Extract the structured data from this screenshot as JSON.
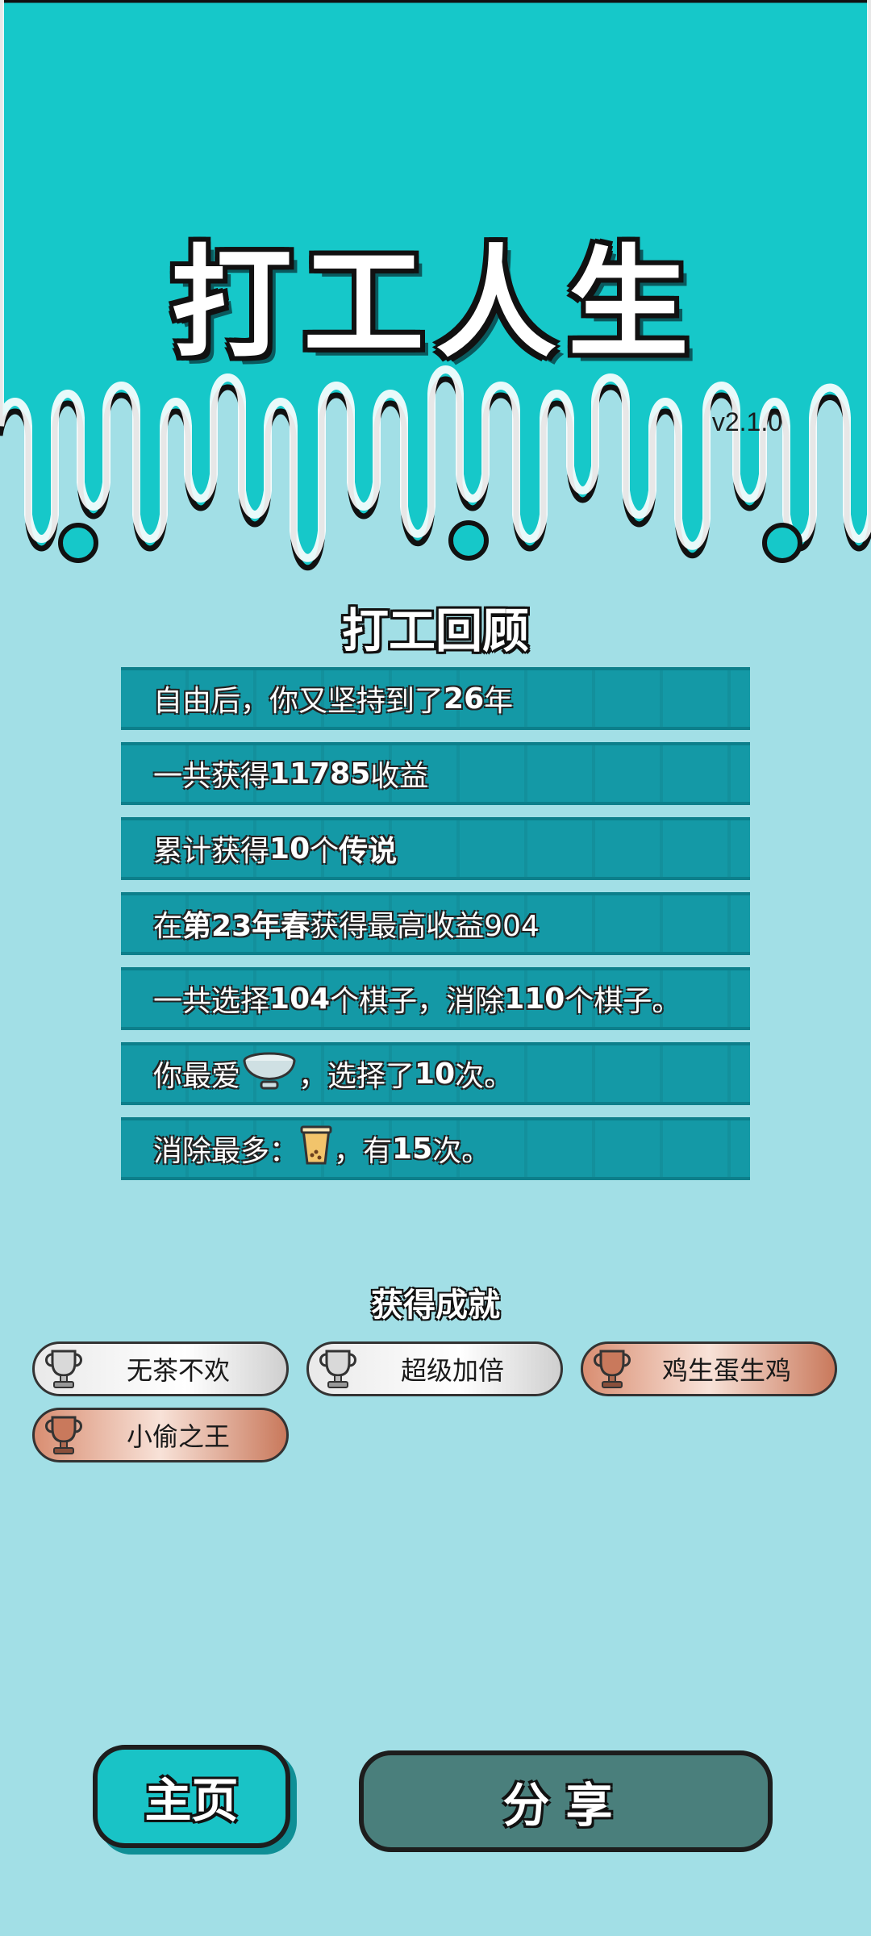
{
  "header": {
    "title": "打工人生",
    "version": "v2.1.0",
    "bg_color": "#16c8c9"
  },
  "review": {
    "title": "打工回顾",
    "rows": [
      {
        "pre": "自由后，你又坚持到了",
        "bold": "26",
        "post": "年"
      },
      {
        "pre": "一共获得",
        "bold": "11785",
        "post": "收益"
      },
      {
        "pre": "累计获得",
        "bold": "10",
        "mid": "个",
        "bold2": "传说"
      },
      {
        "pre": "在 ",
        "bold": "第23年春",
        "post": " 获得最高收益904"
      },
      {
        "pre": "一共选择",
        "bold": "104",
        "mid": "个棋子，消除",
        "bold2": "110",
        "post": "个棋子。"
      },
      {
        "pre": "你最爱",
        "icon": "bowl-icon",
        "mid": "，选择了",
        "bold": "10",
        "post": "次。"
      },
      {
        "pre": "消除最多：",
        "icon": "milk-tea-icon",
        "mid": "，有",
        "bold": "15",
        "post": "次。"
      }
    ]
  },
  "achievements": {
    "title": "获得成就",
    "items": [
      {
        "label": "无茶不欢",
        "tier": "silver"
      },
      {
        "label": "超级加倍",
        "tier": "silver"
      },
      {
        "label": "鸡生蛋生鸡",
        "tier": "bronze"
      },
      {
        "label": "小偷之王",
        "tier": "bronze"
      }
    ]
  },
  "buttons": {
    "home": "主页",
    "share": "分享"
  }
}
